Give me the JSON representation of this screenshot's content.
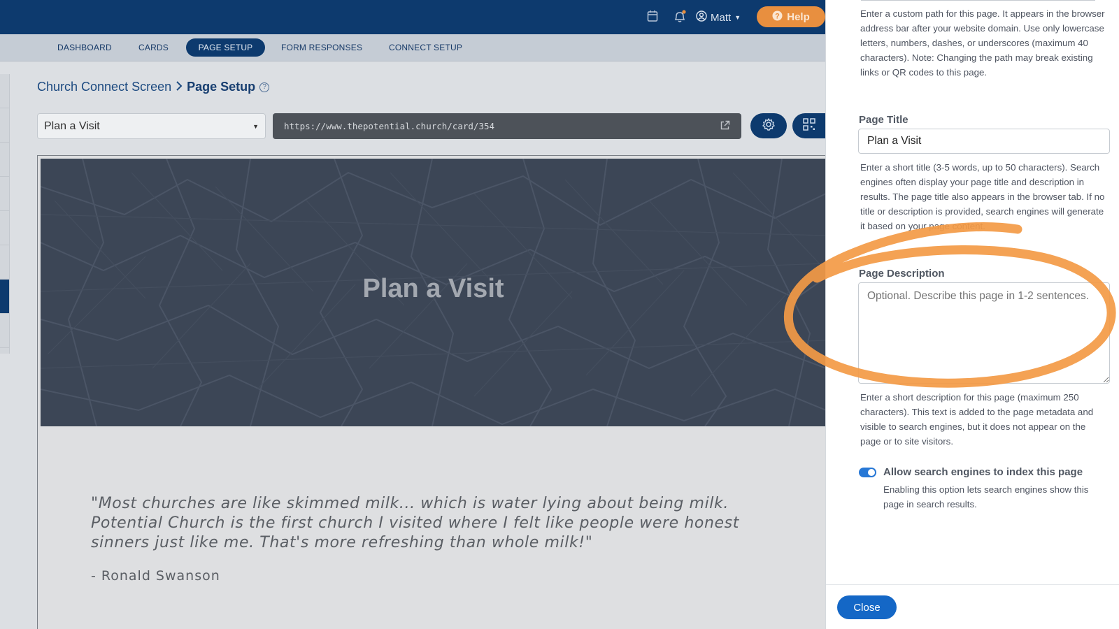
{
  "header": {
    "user_name": "Matt",
    "help_label": "Help"
  },
  "nav": {
    "tabs": [
      {
        "label": "DASHBOARD"
      },
      {
        "label": "CARDS"
      },
      {
        "label": "PAGE SETUP",
        "active": true
      },
      {
        "label": "FORM RESPONSES"
      },
      {
        "label": "CONNECT SETUP"
      }
    ]
  },
  "breadcrumb": {
    "parent": "Church Connect Screen",
    "current": "Page Setup"
  },
  "toolbar": {
    "page_select_value": "Plan a Visit",
    "url": "https://www.thepotential.church/card/354"
  },
  "preview": {
    "hero_title": "Plan a Visit",
    "quote": "\"Most churches are like skimmed milk... which is water lying about being milk. Potential Church is the first church I visited where I felt like people were honest sinners just like me. That's more refreshing than whole milk!\"",
    "author": "- Ronald Swanson"
  },
  "panel": {
    "path_help": "Enter a custom path for this page. It appears in the browser address bar after your website domain. Use only lowercase letters, numbers, dashes, or underscores (maximum 40 characters). Note: Changing the path may break existing links or QR codes to this page.",
    "title_label": "Page Title",
    "title_value": "Plan a Visit",
    "title_help": "Enter a short title (3-5 words, up to 50 characters). Search engines often display your page title and description in results. The page title also appears in the browser tab. If no title or description is provided, search engines will generate it based on your page content.",
    "description_label": "Page Description",
    "description_placeholder": "Optional. Describe this page in 1-2 sentences.",
    "description_help": "Enter a short description for this page (maximum 250 characters). This text is added to the page metadata and visible to search engines, but it does not appear on the page or to site visitors.",
    "index_toggle_label": "Allow search engines to index this page",
    "index_toggle_help": "Enabling this option lets search engines show this page in search results.",
    "index_toggle_on": true,
    "close_label": "Close"
  },
  "colors": {
    "brand": "#0d3a6e",
    "help_button": "#e88f3f",
    "primary": "#1467c6",
    "annotation": "#f39a45"
  }
}
